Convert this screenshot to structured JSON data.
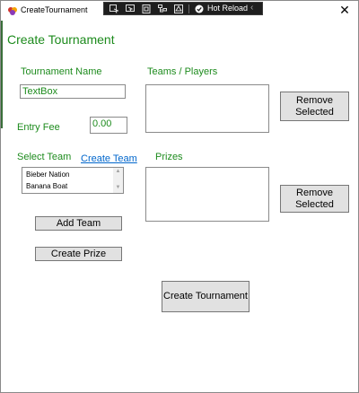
{
  "window": {
    "title": "CreateTournament",
    "close_glyph": "✕"
  },
  "devbar": {
    "hot_reload_label": "Hot Reload",
    "collapse_glyph": "‹"
  },
  "form": {
    "header": "Create Tournament",
    "tournament_name_label": "Tournament Name",
    "tournament_name_value": "TextBox",
    "teams_players_label": "Teams / Players",
    "entry_fee_label": "Entry Fee",
    "entry_fee_value": "0.00",
    "select_team_label": "Select Team",
    "create_team_link": "Create Team",
    "team_options": [
      "Bieber Nation",
      "Banana Boat"
    ],
    "prizes_label": "Prizes",
    "remove_selected_1": "Remove Selected",
    "remove_selected_2": "Remove Selected",
    "add_team_button": "Add Team",
    "create_prize_button": "Create Prize",
    "create_tournament_button": "Create Tournament"
  },
  "colors": {
    "label_green": "#1d8b1d",
    "link_blue": "#0066cc",
    "button_gray": "#e1e1e1"
  },
  "icons": {
    "app": "app-icon",
    "close": "close-icon"
  }
}
